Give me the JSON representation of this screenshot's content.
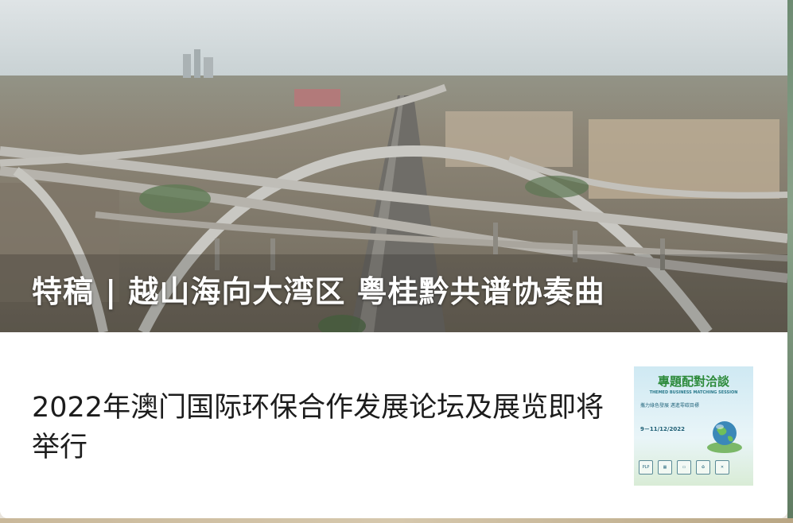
{
  "hero": {
    "title": "特稿 | 越山海向大湾区 粤桂黔共谱协奏曲"
  },
  "article": {
    "title": "2022年澳门国际环保合作发展论坛及展览即将举行",
    "thumbnail": {
      "title": "專題配對洽談",
      "subtitle": "THEMED BUSINESS MATCHING SESSION",
      "tagline": "攜力綠色發展 邁進零碳目標",
      "date": "9－11/12/2022",
      "icon_labels": [
        "PLP",
        "",
        "",
        "",
        ""
      ]
    }
  },
  "colors": {
    "hero_title": "#ffffff",
    "article_title": "#1c1c1c",
    "thumb_accent": "#2c8a3a"
  }
}
